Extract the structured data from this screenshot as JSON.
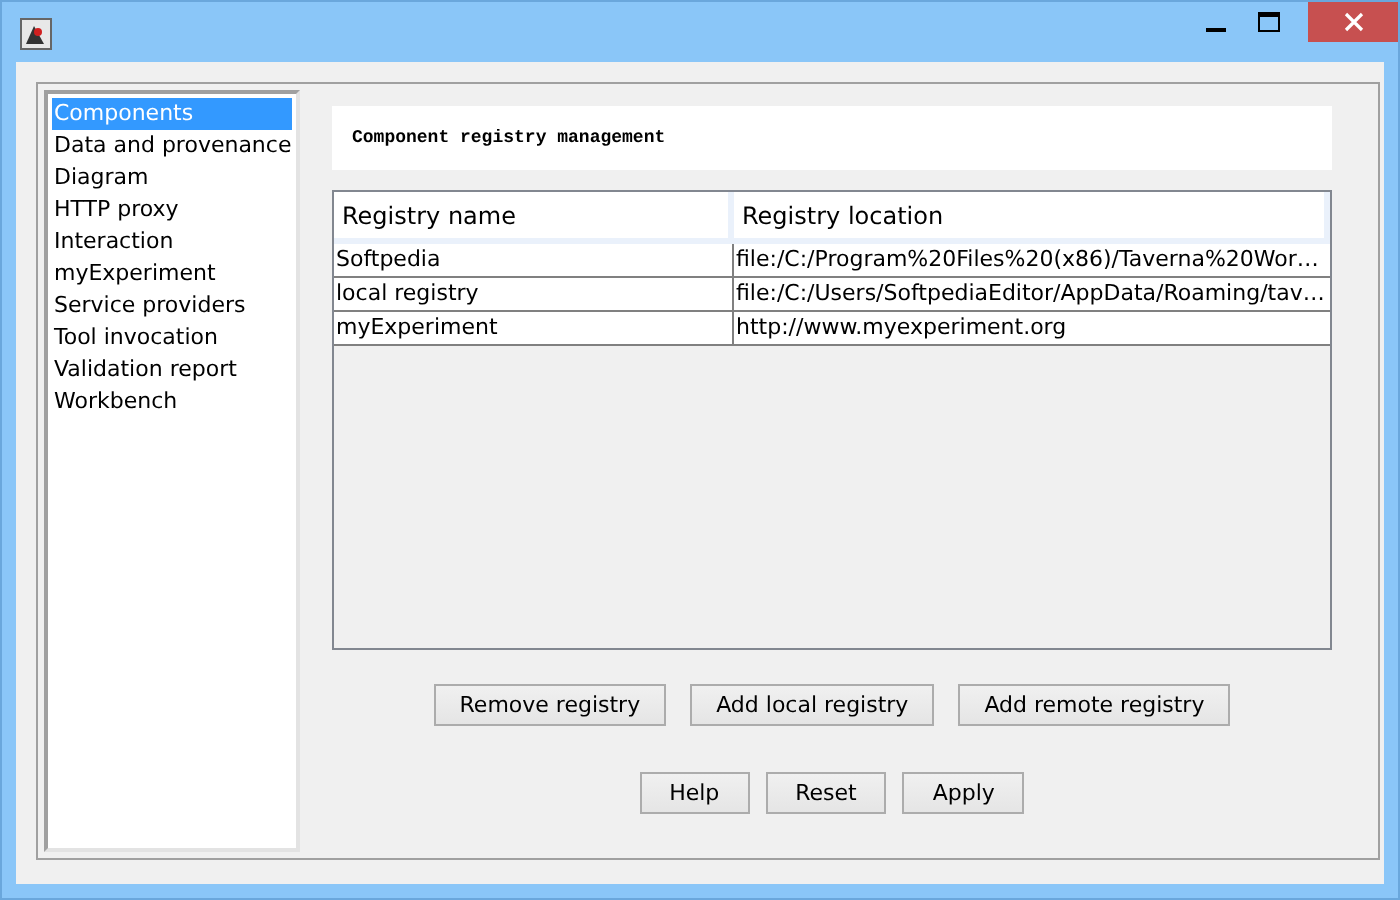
{
  "sidebar": {
    "items": [
      {
        "label": "Components",
        "selected": true
      },
      {
        "label": "Data and provenance",
        "selected": false
      },
      {
        "label": "Diagram",
        "selected": false
      },
      {
        "label": "HTTP proxy",
        "selected": false
      },
      {
        "label": "Interaction",
        "selected": false
      },
      {
        "label": "myExperiment",
        "selected": false
      },
      {
        "label": "Service providers",
        "selected": false
      },
      {
        "label": "Tool invocation",
        "selected": false
      },
      {
        "label": "Validation report",
        "selected": false
      },
      {
        "label": "Workbench",
        "selected": false
      }
    ]
  },
  "panel": {
    "heading": "Component registry management",
    "table": {
      "columns": [
        "Registry name",
        "Registry location"
      ],
      "rows": [
        [
          "Softpedia",
          "file:/C:/Program%20Files%20(x86)/Taverna%20Wor…"
        ],
        [
          "local registry",
          "file:/C:/Users/SoftpediaEditor/AppData/Roaming/tav…"
        ],
        [
          "myExperiment",
          "http://www.myexperiment.org"
        ]
      ]
    },
    "registry_buttons": [
      "Remove registry",
      "Add local registry",
      "Add remote registry"
    ],
    "dialog_buttons": [
      "Help",
      "Reset",
      "Apply"
    ]
  }
}
